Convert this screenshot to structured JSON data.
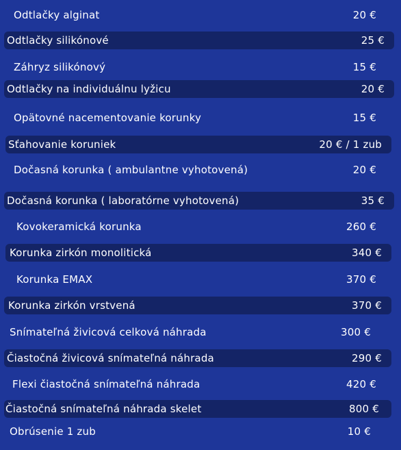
{
  "price_list": [
    {
      "service": "Odtlačky alginat",
      "price": "20 €",
      "highlighted": false
    },
    {
      "service": "Odtlačky silikónové",
      "price": "25 €",
      "highlighted": true
    },
    {
      "service": "Záhryz silikónový",
      "price": "15 €",
      "highlighted": false
    },
    {
      "service": "Odtlačky na individuálnu lyžicu",
      "price": "20 €",
      "highlighted": true
    },
    {
      "service": "Opätovné nacementovanie korunky",
      "price": "15 €",
      "highlighted": false
    },
    {
      "service": "Sťahovanie koruniek",
      "price": "20 € / 1 zub",
      "highlighted": true
    },
    {
      "service": "Dočasná korunka ( ambulantne vyhotovená)",
      "price": "20 €",
      "highlighted": false
    },
    {
      "service": "Dočasná korunka ( laboratórne vyhotovená)",
      "price": "35 €",
      "highlighted": true
    },
    {
      "service": "Kovokeramická korunka",
      "price": "260 €",
      "highlighted": false
    },
    {
      "service": "Korunka zirkón monolitická",
      "price": "340 €",
      "highlighted": true
    },
    {
      "service": "Korunka EMAX",
      "price": "370 €",
      "highlighted": false
    },
    {
      "service": "Korunka zirkón vrstvená",
      "price": "370 €",
      "highlighted": true
    },
    {
      "service": "Snímateľná živicová celková náhrada",
      "price": "300 €",
      "highlighted": false
    },
    {
      "service": "Čiastočná živicová snímateľná náhrada",
      "price": "290 €",
      "highlighted": true
    },
    {
      "service": "Flexi čiastočná snímateľná náhrada",
      "price": "420 €",
      "highlighted": false
    },
    {
      "service": "Čiastočná snímateľná náhrada skelet",
      "price": "800 €",
      "highlighted": true
    },
    {
      "service": "Obrúsenie 1 zub",
      "price": "10 €",
      "highlighted": false
    }
  ],
  "colors": {
    "background": "#1e3699",
    "band": "#142466",
    "text": "#ffffff"
  }
}
